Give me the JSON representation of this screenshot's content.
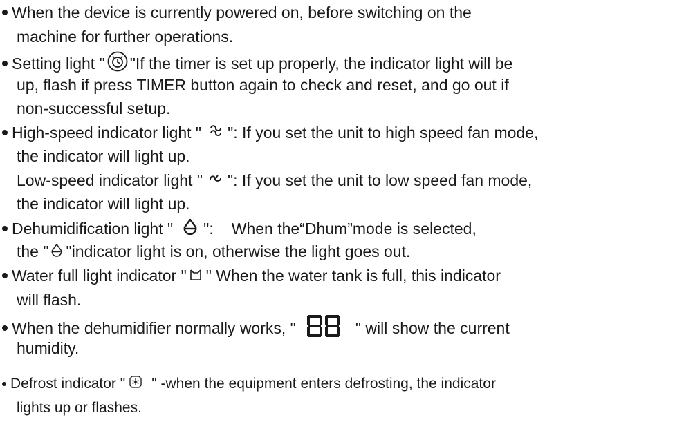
{
  "items": [
    {
      "l1": "When the device is currently powered on, before switching on the",
      "l2": "machine for further operations."
    },
    {
      "l1a": "Setting light \"",
      "l1b": "\"If the timer is set up properly, the indicator light will be",
      "l2": "up, flash if press TIMER button again to check and reset, and go out if",
      "l3": "non-successful setup.",
      "icon": "timer-clock-icon"
    },
    {
      "l1a": "High-speed indicator light \"",
      "l1b": "\": If you set the unit to high speed fan mode,",
      "l2": "the indicator will light up.",
      "l3a": "Low-speed indicator light \"",
      "l3b": "\": If you set the unit to low speed fan mode,",
      "l4": "the indicator will light up.",
      "icon_high": "high-speed-fan-icon",
      "icon_low": "low-speed-fan-icon"
    },
    {
      "l1a": "Dehumidification light \"",
      "l1b": "\":",
      "l1c": "When the“Dhum”mode is selected,",
      "l2a": "the \"",
      "l2b": "\"indicator light is on, otherwise the light goes out.",
      "icon": "water-drop-icon"
    },
    {
      "l1a": "Water full light indicator \"",
      "l1b": "\" When the water tank is full, this indicator",
      "l2": "will flash.",
      "icon": "water-tank-icon"
    },
    {
      "l1a": "When the dehumidifier normally works, \"",
      "l1b": "\" will show the current",
      "l2": "humidity.",
      "icon": "seven-segment-display-icon"
    },
    {
      "l1a": "Defrost indicator \"",
      "l1b": "\" -when the equipment enters defrosting, the indicator",
      "l2": "lights up or flashes.",
      "icon": "defrost-snowflake-icon"
    }
  ]
}
